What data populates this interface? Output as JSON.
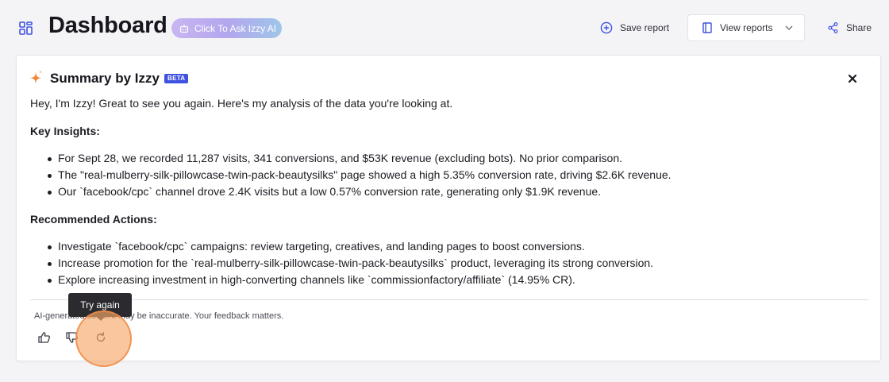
{
  "header": {
    "title": "Dashboard",
    "ask_ai_label": "Click To Ask Izzy AI",
    "save_report_label": "Save report",
    "view_reports_label": "View reports",
    "share_label": "Share",
    "icons": [
      "dashboard-grid-icon",
      "robot-icon",
      "plus-circle-icon",
      "bookmark-icon",
      "chevron-down-icon",
      "share-icon"
    ]
  },
  "summary": {
    "title": "Summary by Izzy",
    "badge": "BETA",
    "greeting": "Hey, I'm Izzy! Great to see you again. Here's my analysis of the data you're looking at.",
    "key_insights": {
      "heading": "Key Insights:",
      "items": [
        "For Sept 28, we recorded 11,287 visits, 341 conversions, and $53K revenue (excluding bots). No prior comparison.",
        "The \"real-mulberry-silk-pillowcase-twin-pack-beautysilks\" page showed a high 5.35% conversion rate, driving $2.6K revenue.",
        "Our `facebook/cpc` channel drove 2.4K visits but a low 0.57% conversion rate, generating only $1.9K revenue."
      ]
    },
    "recommended_actions": {
      "heading": "Recommended Actions:",
      "items": [
        "Investigate `facebook/cpc` campaigns: review targeting, creatives, and landing pages to boost conversions.",
        "Increase promotion for the `real-mulberry-silk-pillowcase-twin-pack-beautysilks` product, leveraging its strong conversion.",
        "Explore increasing investment in high-converting channels like `commissionfactory/affiliate` (14.95% CR)."
      ]
    },
    "disclaimer": "AI-generated content may be inaccurate. Your feedback matters.",
    "tooltip": "Try again"
  },
  "colors": {
    "accent": "#3f51e0",
    "sparkle": "#f0883a",
    "click_marker": "#f8a868"
  }
}
